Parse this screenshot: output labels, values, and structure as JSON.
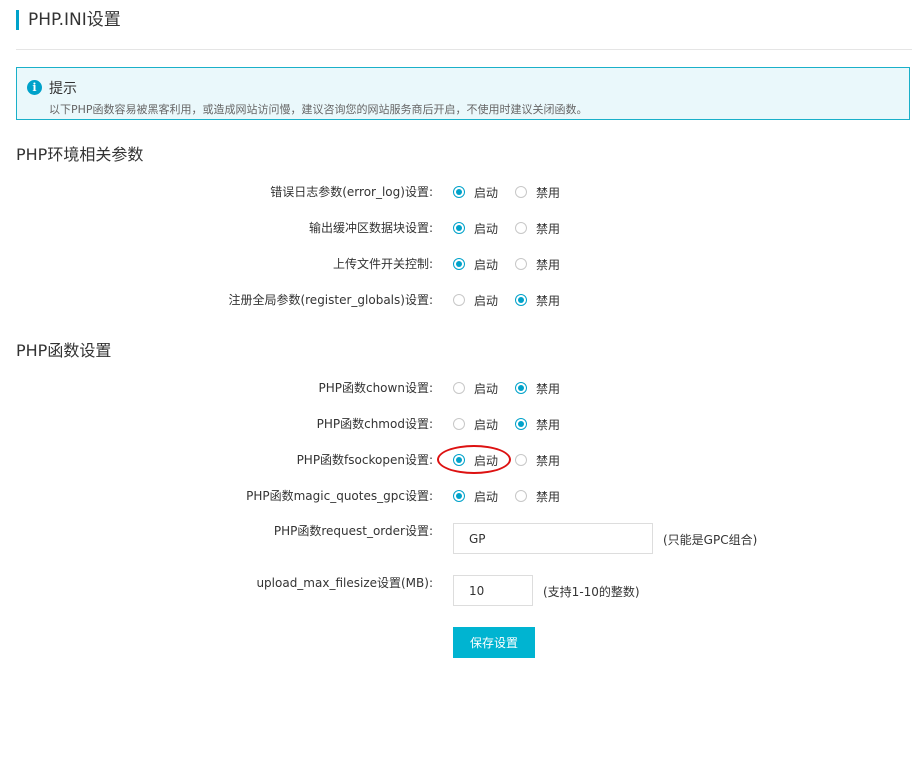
{
  "page_title": "PHP.INI设置",
  "tip": {
    "icon": "info-icon",
    "icon_glyph": "i",
    "title": "提示",
    "text": "以下PHP函数容易被黑客利用，或造成网站访问慢，建议咨询您的网站服务商后开启，不使用时建议关闭函数。"
  },
  "sections": {
    "env_title": "PHP环境相关参数",
    "func_title": "PHP函数设置"
  },
  "options": {
    "on": "启动",
    "off": "禁用"
  },
  "env_settings": [
    {
      "label": "错误日志参数(error_log)设置:",
      "value": "on"
    },
    {
      "label": "输出缓冲区数据块设置:",
      "value": "on"
    },
    {
      "label": "上传文件开关控制:",
      "value": "on"
    },
    {
      "label": "注册全局参数(register_globals)设置:",
      "value": "off"
    }
  ],
  "func_settings": [
    {
      "label": "PHP函数chown设置:",
      "value": "off"
    },
    {
      "label": "PHP函数chmod设置:",
      "value": "off"
    },
    {
      "label": "PHP函数fsockopen设置:",
      "value": "on"
    },
    {
      "label": "PHP函数magic_quotes_gpc设置:",
      "value": "on"
    }
  ],
  "request_order": {
    "label": "PHP函数request_order设置:",
    "value": "GP",
    "hint": "(只能是GPC组合)"
  },
  "upload_max": {
    "label": "upload_max_filesize设置(MB):",
    "value": "10",
    "hint": "(支持1-10的整数)"
  },
  "save_label": "保存设置",
  "accent_color": "#00a2ca",
  "annotation_color": "#dd1111"
}
